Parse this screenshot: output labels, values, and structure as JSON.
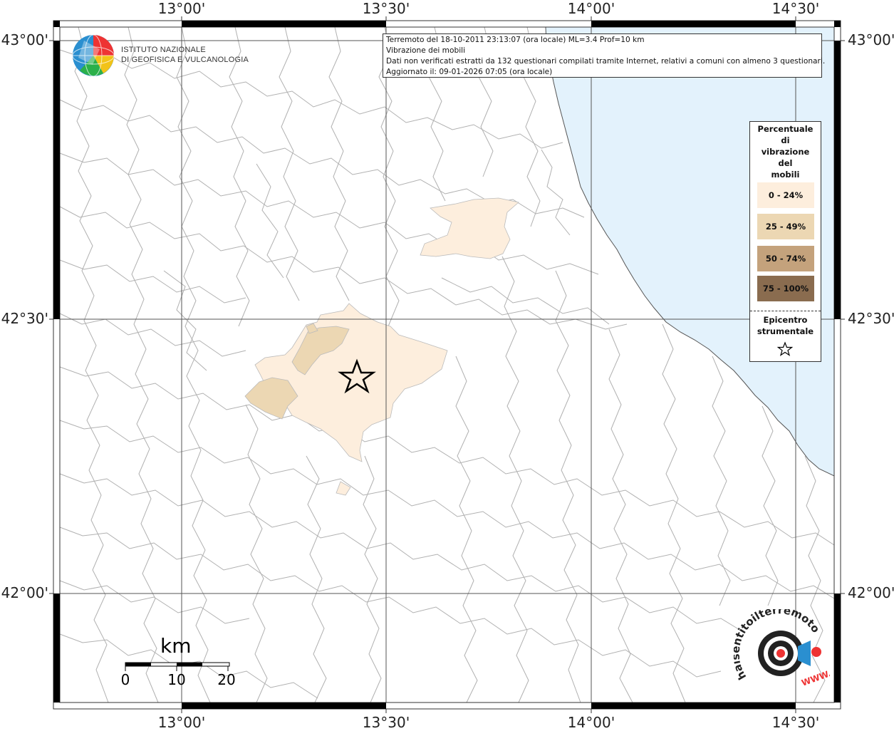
{
  "map": {
    "lon_ticks": [
      "13°00'",
      "13°30'",
      "14°00'",
      "14°30'"
    ],
    "lat_ticks": [
      "43°00'",
      "42°30'",
      "42°00'"
    ],
    "colors": {
      "sea": "#e3f2fc",
      "land": "#ffffff",
      "boundary": "#aaaaaa",
      "class_0_24": "#fdeedd",
      "class_25_49": "#ecd7b3",
      "class_50_74": "#c4a27c",
      "class_75_100": "#8a6c4f"
    }
  },
  "header": {
    "line1": "Terremoto del 18-10-2011 23:13:07 (ora locale) ML=3.4 Prof=10 km",
    "line2": "Vibrazione dei mobili",
    "line3": "Dati non verificati estratti da 132 questionari compilati tramite Internet, relativi a comuni con almeno 3 questionari.",
    "line4": "Aggiornato il: 09-01-2026 07:05 (ora locale)"
  },
  "logo": {
    "line1": "ISTITUTO NAZIONALE",
    "line2": "DI GEOFISICA E VULCANOLOGIA"
  },
  "legend": {
    "title_lines": [
      "Percentuale",
      "di",
      "vibrazione",
      "del",
      "mobili"
    ],
    "classes": [
      "0 - 24%",
      "25 - 49%",
      "50 - 74%",
      "75 - 100%"
    ],
    "epicenter_line1": "Epicentro",
    "epicenter_line2": "strumentale"
  },
  "scale": {
    "title": "km",
    "labels": [
      "0",
      "10",
      "20"
    ]
  },
  "brand": {
    "text": "haisentitoilterremoto.it",
    "url_text": "WWW."
  }
}
